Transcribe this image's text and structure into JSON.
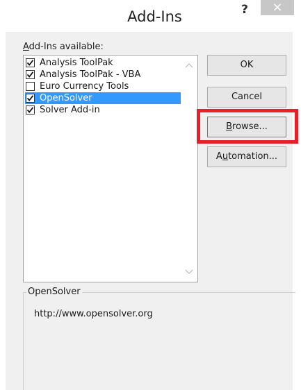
{
  "window": {
    "title": "Add-Ins",
    "help_label": "?",
    "close_label": "×"
  },
  "addins": {
    "label_prefix": "A",
    "label_rest": "dd-Ins available:",
    "items": [
      {
        "label": "Analysis ToolPak",
        "checked": true,
        "selected": false
      },
      {
        "label": "Analysis ToolPak - VBA",
        "checked": true,
        "selected": false
      },
      {
        "label": "Euro Currency Tools",
        "checked": false,
        "selected": false
      },
      {
        "label": "OpenSolver",
        "checked": true,
        "selected": true
      },
      {
        "label": "Solver Add-in",
        "checked": true,
        "selected": false
      }
    ],
    "scroll_up_icon": "chevron-up-icon",
    "scroll_down_icon": "chevron-down-icon"
  },
  "buttons": {
    "ok_label": "OK",
    "cancel_label": "Cancel",
    "browse_prefix": "B",
    "browse_rest": "rowse...",
    "automation_prefix": "A",
    "automation_mnemonic": "u",
    "automation_rest": "tomation..."
  },
  "details": {
    "title": "OpenSolver",
    "description": "http://www.opensolver.org"
  },
  "colors": {
    "selection": "#3399ff",
    "highlight_box": "#e8202a",
    "close_button": "#c7c7c7"
  }
}
